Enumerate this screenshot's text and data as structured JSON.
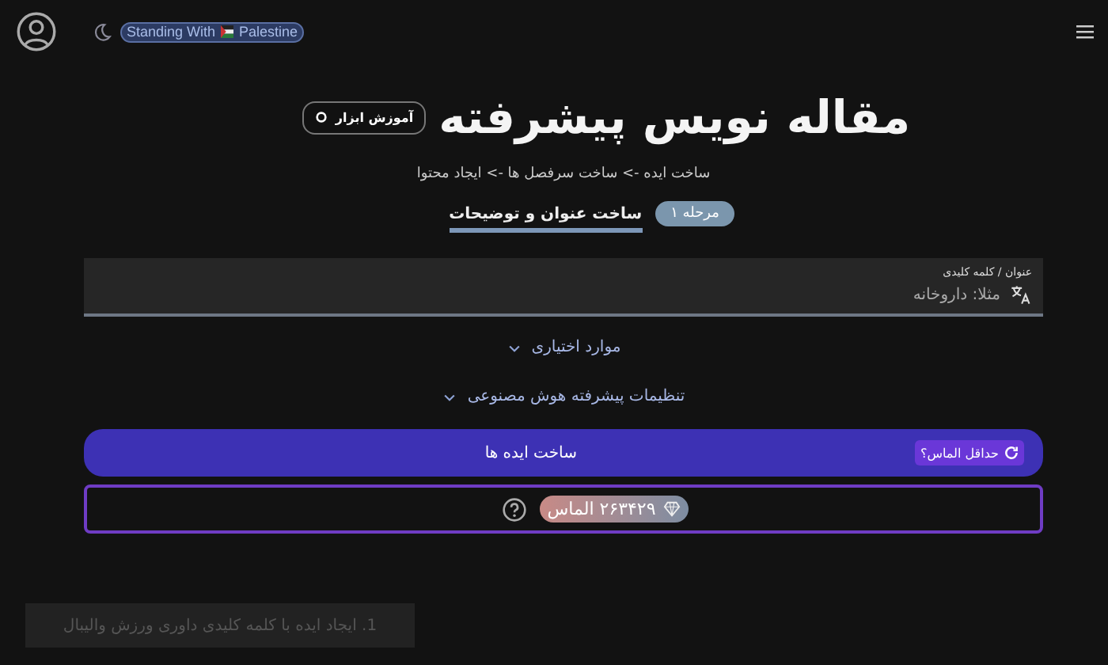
{
  "header": {
    "banner_before": "Standing With",
    "banner_after": "Palestine"
  },
  "title": "مقاله نویس پیشرفته",
  "tutorial_button": "آموزش ابزار",
  "subtitle": "ساخت ایده -> ساخت سرفصل ها -> ایجاد محتوا",
  "steps": [
    {
      "badge": "مرحله ۱",
      "label": "ساخت عنوان و توضیحات",
      "selected": true
    }
  ],
  "field": {
    "label": "عنوان / کلمه کلیدی",
    "placeholder": "مثلا: داروخانه"
  },
  "sections": [
    {
      "label": "موارد اختیاری",
      "expanded": false
    },
    {
      "label": "تنظیمات پیشرفته هوش مصنوعی",
      "expanded": false
    }
  ],
  "generate_button": "ساخت ایده ها",
  "min_diamonds": "حداقل الماس؟",
  "balance": "۲۶۳۴۲۹ الماس",
  "toast": "1. ایجاد ایده با کلمه کلیدی داوری ورزش والیبال"
}
